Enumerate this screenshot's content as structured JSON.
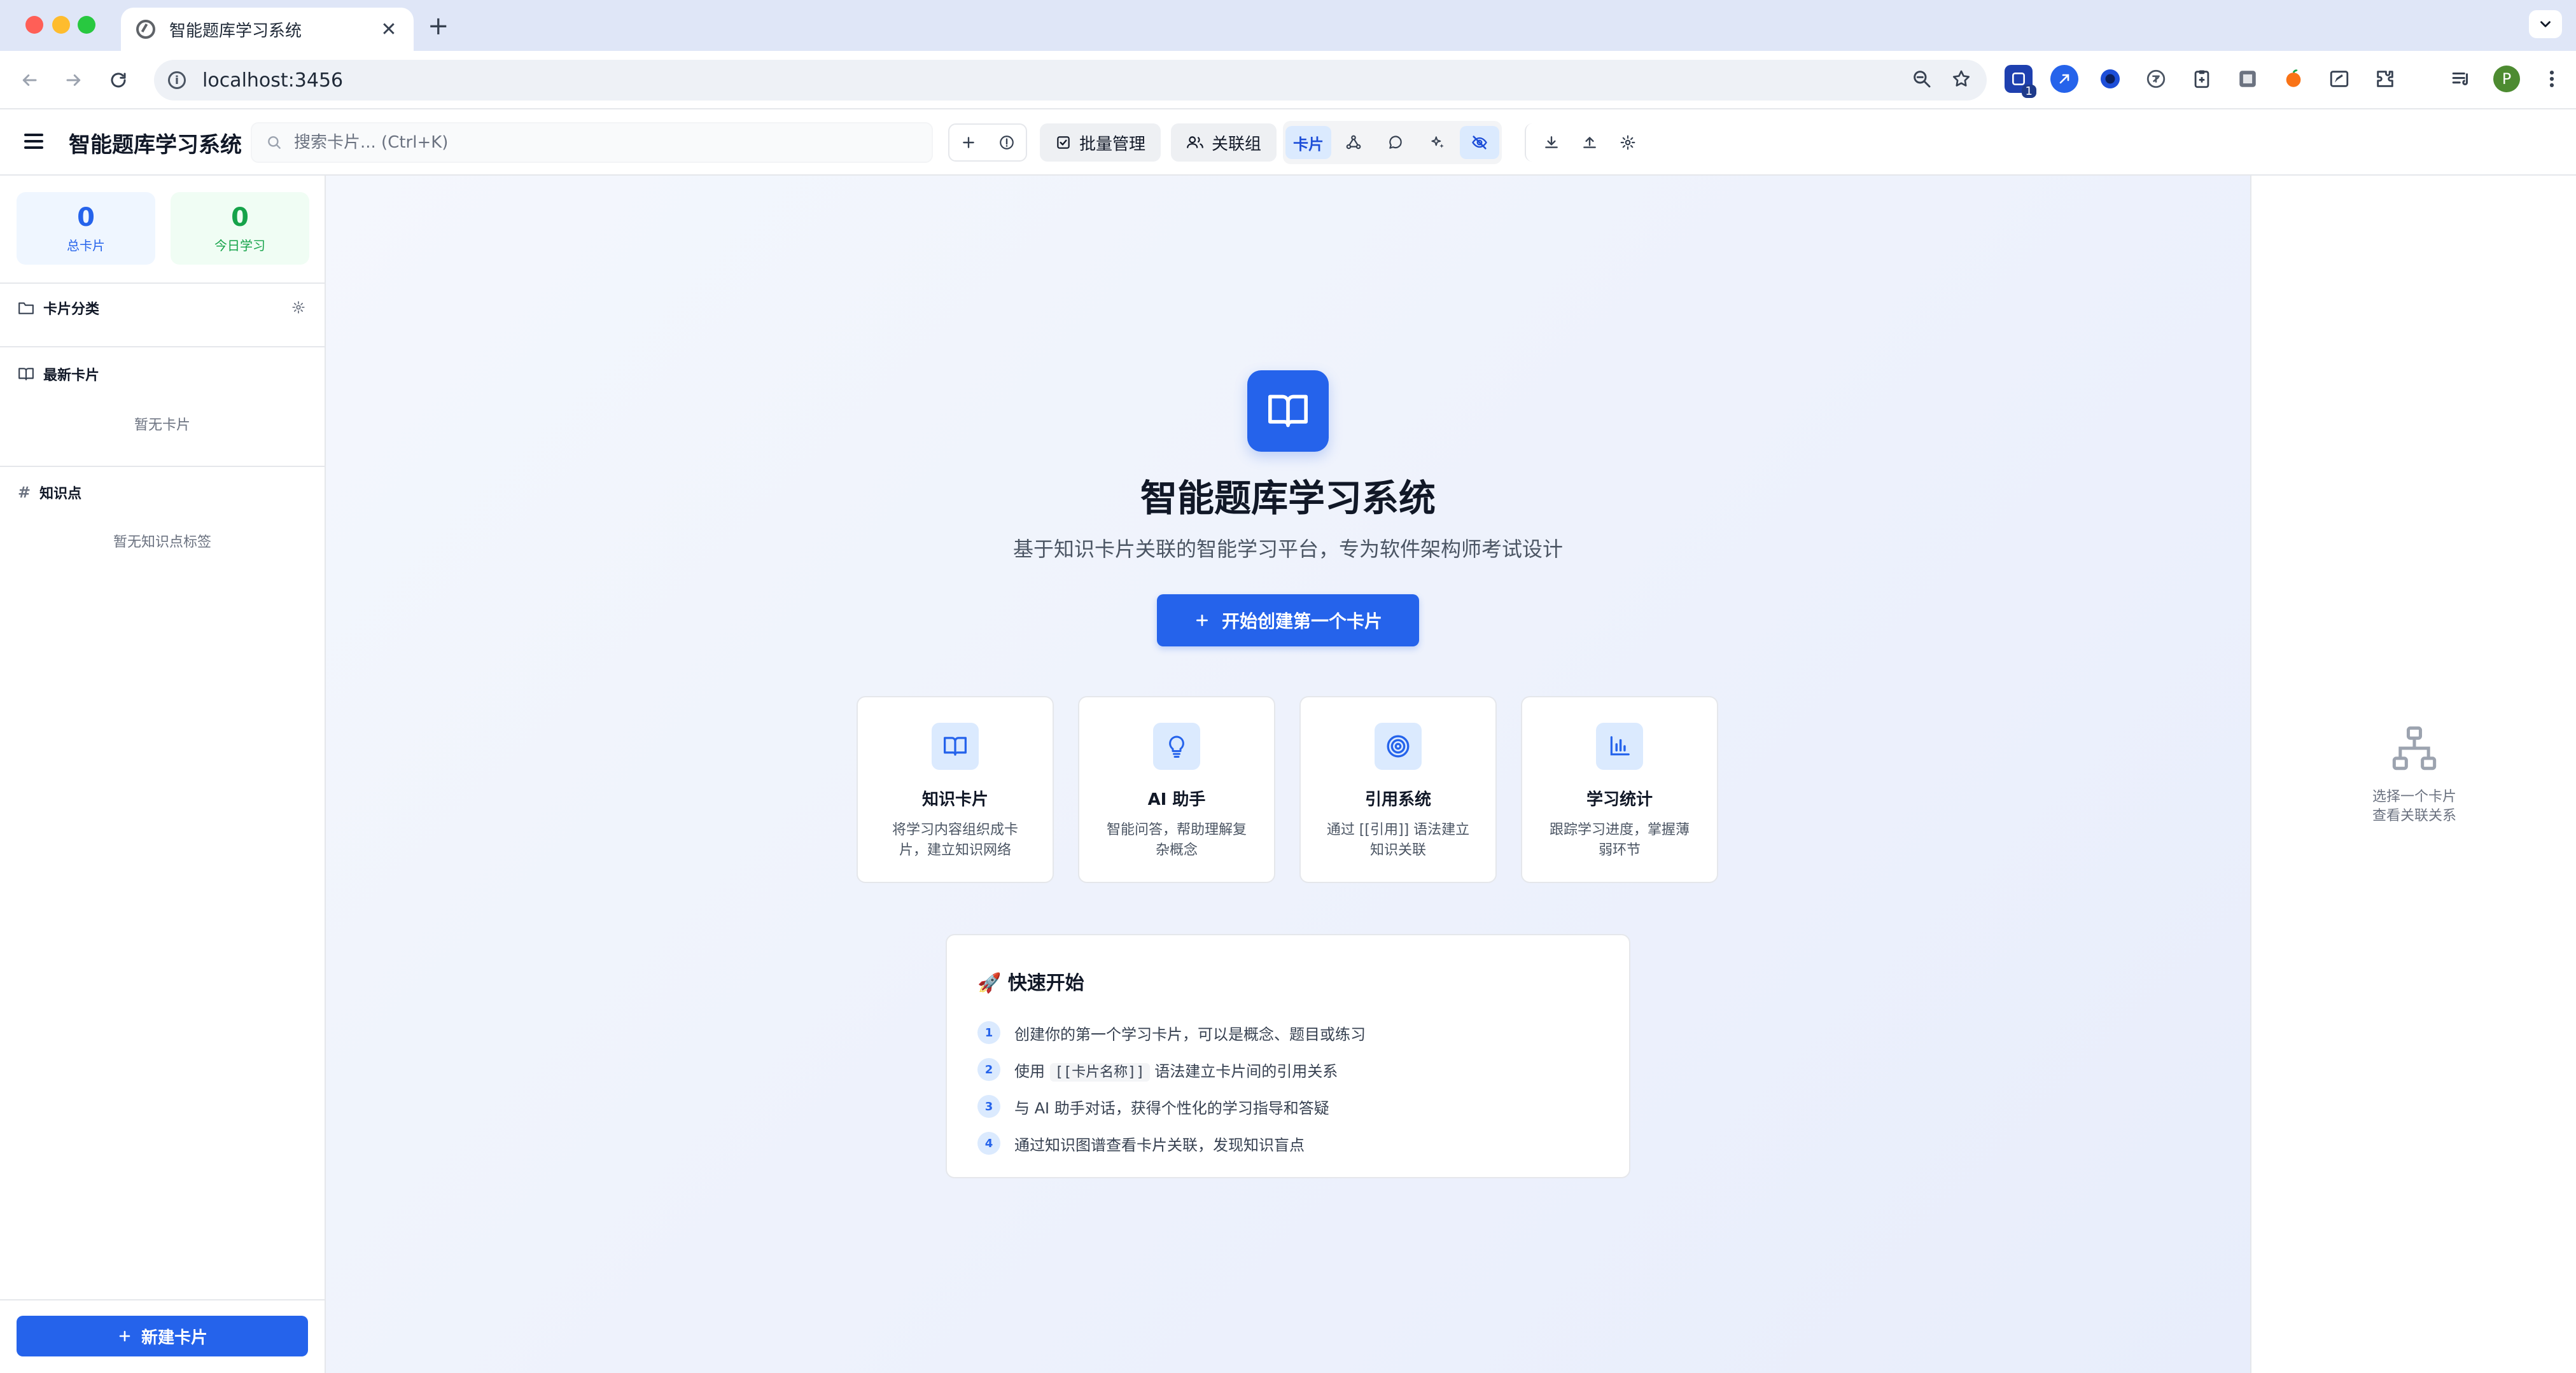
{
  "browser": {
    "tab_title": "智能题库学习系统",
    "url": "localhost:3456",
    "ext_badge": "1",
    "profile_initial": "P"
  },
  "header": {
    "title": "智能题库学习系统",
    "search_placeholder": "搜索卡片... (Ctrl+K)",
    "batch_label": "批量管理",
    "group_label": "关联组",
    "view_card_label": "卡片"
  },
  "sidebar": {
    "stats": [
      {
        "value": "0",
        "label": "总卡片"
      },
      {
        "value": "0",
        "label": "今日学习"
      }
    ],
    "categories_title": "卡片分类",
    "recent_title": "最新卡片",
    "recent_empty": "暂无卡片",
    "tags_title": "知识点",
    "tags_empty": "暂无知识点标签",
    "new_card_label": "新建卡片"
  },
  "main": {
    "title": "智能题库学习系统",
    "subtitle": "基于知识卡片关联的智能学习平台，专为软件架构师考试设计",
    "cta_label": "开始创建第一个卡片",
    "features": [
      {
        "title": "知识卡片",
        "desc": "将学习内容组织成卡片，建立知识网络",
        "icon": "book-open-icon"
      },
      {
        "title": "AI 助手",
        "desc": "智能问答，帮助理解复杂概念",
        "icon": "lightbulb-icon"
      },
      {
        "title": "引用系统",
        "desc": "通过 [[引用]] 语法建立知识关联",
        "icon": "target-icon"
      },
      {
        "title": "学习统计",
        "desc": "跟踪学习进度，掌握薄弱环节",
        "icon": "bar-chart-icon"
      }
    ],
    "quick_start": {
      "title": "🚀 快速开始",
      "steps": [
        {
          "num": "1",
          "text": "创建你的第一个学习卡片，可以是概念、题目或练习"
        },
        {
          "num": "2",
          "pre": "使用",
          "code": "[[卡片名称]]",
          "post": "语法建立卡片间的引用关系"
        },
        {
          "num": "3",
          "text": "与 AI 助手对话，获得个性化的学习指导和答疑"
        },
        {
          "num": "4",
          "text": "通过知识图谱查看卡片关联，发现知识盲点"
        }
      ]
    }
  },
  "right_panel": {
    "line1": "选择一个卡片",
    "line2": "查看关联关系"
  },
  "colors": {
    "primary": "#2563eb",
    "primary_light": "#dbeafe",
    "success": "#16a34a"
  }
}
